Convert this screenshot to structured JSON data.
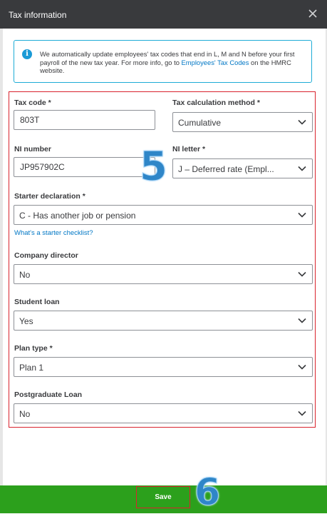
{
  "dialog": {
    "title": "Tax information"
  },
  "info": {
    "text": "We automatically update employees' tax codes that end in L, M and N before your first payroll of the new tax year. For more info, go to ",
    "link": "Employees' Tax Codes",
    "after": " on the HMRC website."
  },
  "fields": {
    "tax_code": {
      "label": "Tax code *",
      "value": "803T"
    },
    "tax_calc": {
      "label": "Tax calculation method *",
      "value": "Cumulative"
    },
    "ni_number": {
      "label": "NI number",
      "value": "JP957902C"
    },
    "ni_letter": {
      "label": "NI letter *",
      "value": "J – Deferred rate (Empl..."
    },
    "starter": {
      "label": "Starter declaration *",
      "value": "C - Has another job or pension"
    },
    "starter_link": "What's a starter checklist?",
    "director": {
      "label": "Company director",
      "value": "No"
    },
    "student": {
      "label": "Student loan",
      "value": "Yes"
    },
    "plan": {
      "label": "Plan type *",
      "value": "Plan 1"
    },
    "postgrad": {
      "label": "Postgraduate Loan",
      "value": "No"
    }
  },
  "annotations": {
    "step5": "5",
    "step6": "6"
  },
  "footer": {
    "save_label": "Save"
  },
  "icons": {
    "close": "close-icon",
    "info": "info-icon",
    "chevron": "chevron-down-icon"
  },
  "colors": {
    "accent_green": "#2ca01c",
    "highlight_red": "#d9232e",
    "link_blue": "#0077c5",
    "header": "#393a3d"
  }
}
